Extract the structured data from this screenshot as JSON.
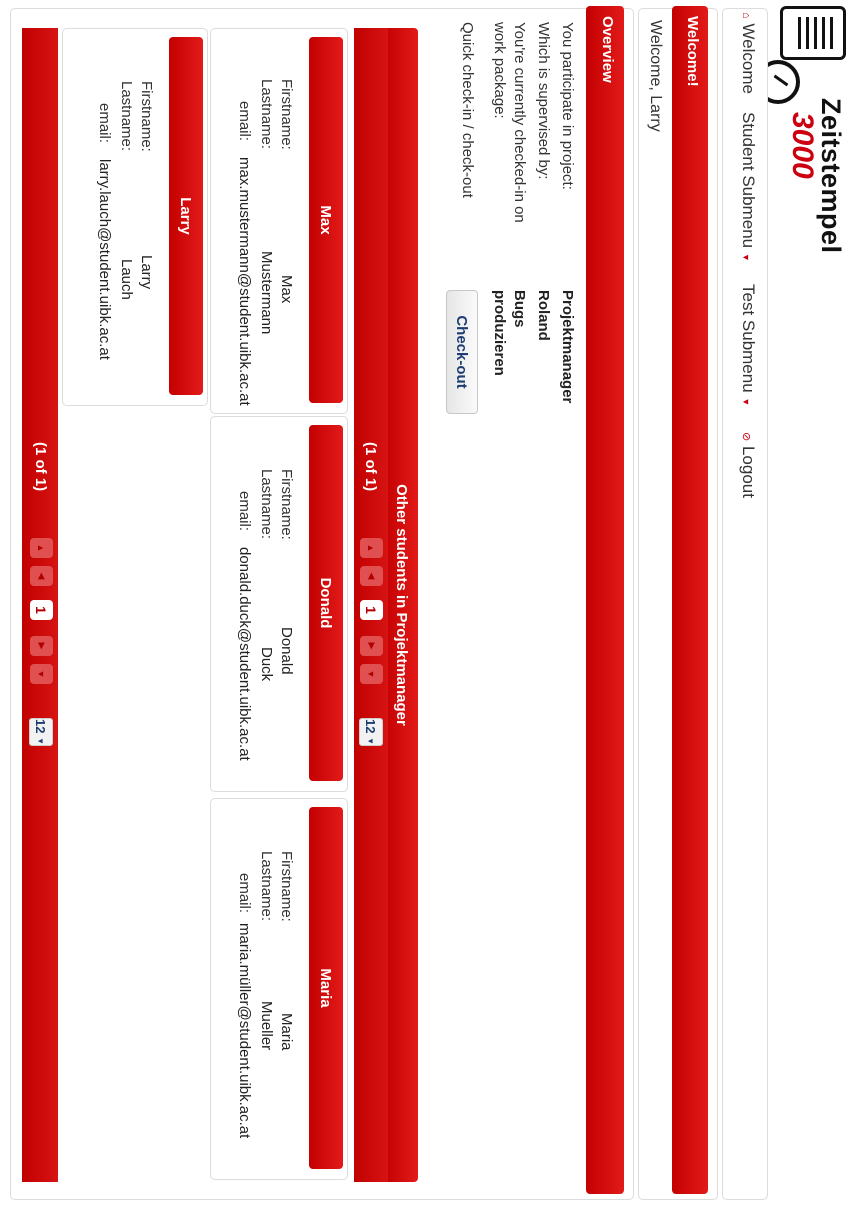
{
  "logo": {
    "line1": "Zeitstempel",
    "line2": "3000"
  },
  "menu": {
    "welcome": "Welcome",
    "student_submenu": "Student Submenu",
    "test_submenu": "Test Submenu",
    "logout": "Logout"
  },
  "welcome_panel": {
    "title": "Welcome!",
    "text": "Welcome, Larry"
  },
  "overview": {
    "title": "Overview",
    "project_label": "You participate in project:",
    "project_value": "Projektmanager",
    "supervisor_label": "Which is supervised by:",
    "supervisor_value": "Roland",
    "workpackage_label_1": "You're currently checked-in on",
    "workpackage_label_2": "work package:",
    "workpackage_value_1": "Bugs",
    "workpackage_value_2": "produzieren",
    "quick_label": "Quick check-in / check-out",
    "checkout_button": "Check-out"
  },
  "students": {
    "title": "Other students in Projektmanager",
    "paginator": {
      "count": "(1 of 1)",
      "current_page": "1",
      "rows_per_page": "12"
    },
    "field_labels": {
      "firstname": "Firstname:",
      "lastname": "Lastname:",
      "email": "email:"
    },
    "cards": [
      {
        "header": "Max",
        "firstname": "Max",
        "lastname": "Mustermann",
        "email": "max.mustermann@student.uibk.ac.at"
      },
      {
        "header": "Donald",
        "firstname": "Donald",
        "lastname": "Duck",
        "email": "donald.duck@student.uibk.ac.at"
      },
      {
        "header": "Maria",
        "firstname": "Maria",
        "lastname": "Mueller",
        "email": "maria.müller@student.uibk.ac.at"
      },
      {
        "header": "Larry",
        "firstname": "Larry",
        "lastname": "Lauch",
        "email": "larry.lauch@student.uibk.ac.at"
      }
    ]
  },
  "colors": {
    "accent": "#cc0010",
    "button_text": "#1e3d73"
  }
}
